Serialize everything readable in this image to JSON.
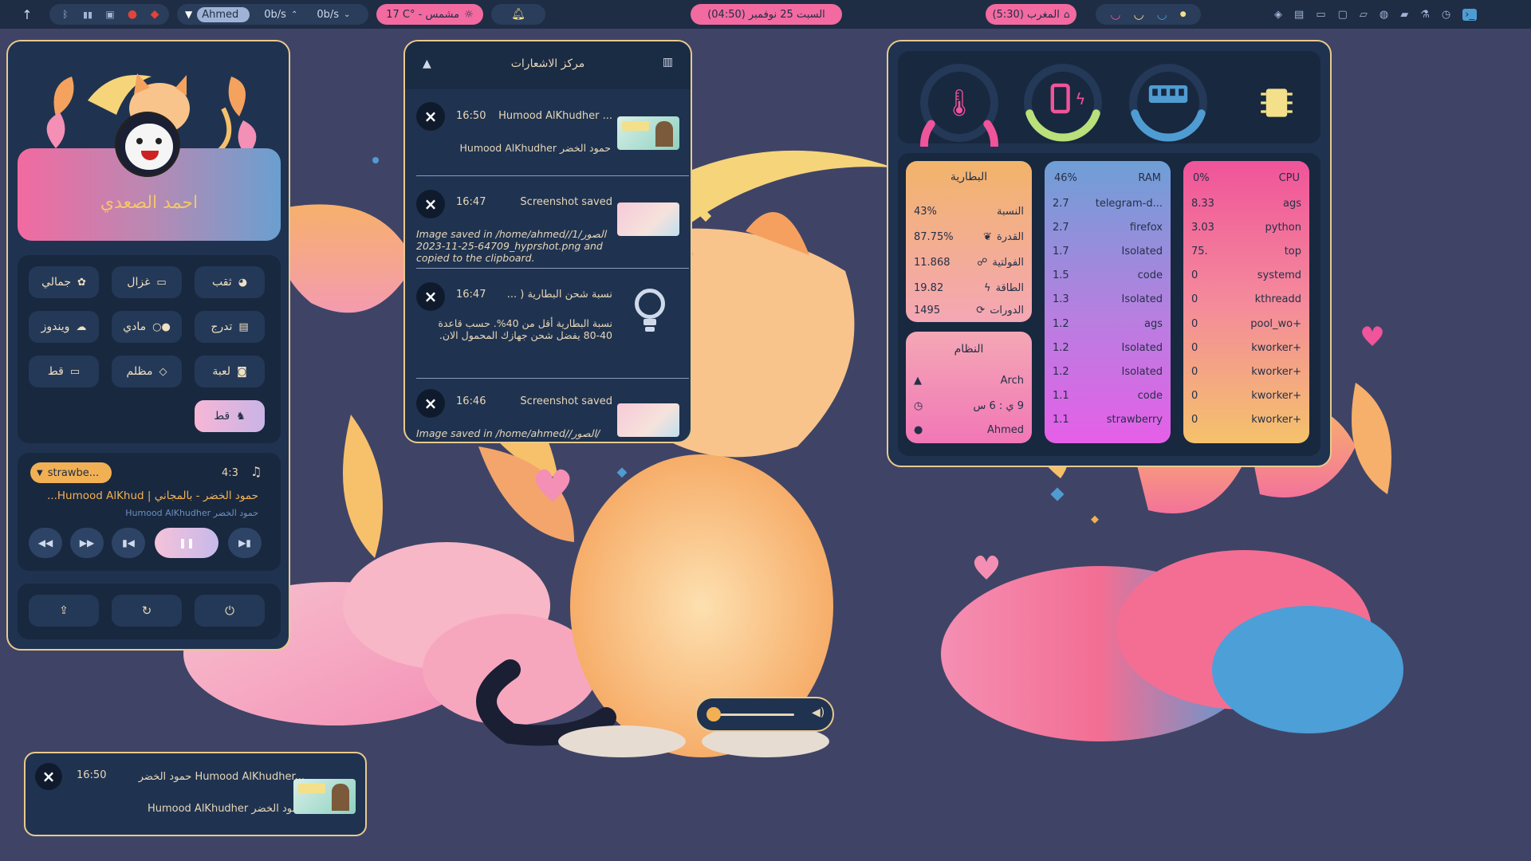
{
  "colors": {
    "bar_bg": "#1e2d44",
    "panel_bg": "#1f3350",
    "panel_border": "#e9c98d",
    "accent_orange": "#f2b054",
    "accent_pink": "#f0549a",
    "accent_green": "#b9e07a",
    "accent_blue": "#4f9cd3",
    "accent_yellow": "#f4e08a"
  },
  "topbar": {
    "up_icon": "arrow-up-icon",
    "tray_icons": [
      "bluetooth-icon",
      "signal-icon",
      "sd-card-icon",
      "red-app-icon",
      "red-app-icon-2"
    ],
    "network_user": "Ahmed",
    "net_down": "0b/s",
    "net_up": "0b/s",
    "weather": "17 C° - مشمس",
    "weather_icon": "sun-icon",
    "notification_icon": "bell-ring-icon",
    "clock": "السبت 25 نوفمبر (04:50)",
    "prayer": "المغرب (5:30)",
    "prayer_icon": "mosque-icon",
    "right_icons": [
      "layers-icon",
      "file-icon",
      "ticket-icon",
      "box-icon",
      "chat-icon",
      "database-icon",
      "folder-icon",
      "flask-icon",
      "history-icon",
      "terminal-icon"
    ]
  },
  "left_panel": {
    "user_name": "احمد الصعدي",
    "quick_buttons": [
      {
        "label": "ثقب",
        "icon": "blackhole-icon"
      },
      {
        "label": "غزال",
        "icon": "monitor-icon"
      },
      {
        "label": "جمالي",
        "icon": "palette-icon"
      },
      {
        "label": "تدرج",
        "icon": "gradient-icon"
      },
      {
        "label": "مادي",
        "icon": "material-icon"
      },
      {
        "label": "ويندوز",
        "icon": "windows-icon"
      },
      {
        "label": "لعبة",
        "icon": "gamepad-icon"
      },
      {
        "label": "مظلم",
        "icon": "dark-icon"
      },
      {
        "label": "قط",
        "icon": "monitor-icon"
      },
      {
        "label": "قط",
        "icon": "cat-icon"
      }
    ],
    "media": {
      "player": "strawbe...",
      "position": "4:3",
      "title": "حمود الخضر - بالمجاني | Humood AlKhud...",
      "artist": "حمود الخضر Humood AlKhudher",
      "controls": [
        "rewind-icon",
        "fast-forward-icon",
        "previous-icon",
        "pause-icon",
        "next-icon"
      ]
    },
    "power_buttons": [
      "logout-icon",
      "restart-icon",
      "power-icon"
    ]
  },
  "notification_center": {
    "title": "مركز الاشعارات",
    "items": [
      {
        "time": "16:50",
        "title": "Humood AlKhudher ...",
        "body": "حمود الخضر Humood AlKhudher",
        "thumb": "album-art"
      },
      {
        "time": "16:47",
        "title": "Screenshot saved",
        "body": "Image saved in /home/ahmed//الصور/164709-25-11-2023_hyprshot.png and copied to the clipboard.",
        "thumb": "screenshot"
      },
      {
        "time": "16:47",
        "title": "نسبة شحن البطارية ( ...",
        "body": "نسبة البطارية أقل من 40%. حسب قاعدة 40-80 يفضل شحن جهازك المحمول الان.",
        "thumb": "lightbulb-icon"
      },
      {
        "time": "16:46",
        "title": "Screenshot saved",
        "body": "Image saved in /home/ahmed//الصور/",
        "thumb": "screenshot"
      }
    ]
  },
  "system_monitor": {
    "gauges": [
      {
        "name": "temperature",
        "icon": "thermometer-icon",
        "color": "#f0549a",
        "value": 0.55
      },
      {
        "name": "battery",
        "icon": "battery-charging-icon",
        "color": "#b9e07a",
        "value": 0.43
      },
      {
        "name": "memory",
        "icon": "ram-icon",
        "color": "#4f9cd3",
        "value": 0.46
      },
      {
        "name": "cpu",
        "icon": "cpu-icon",
        "color": "#f4e08a",
        "value": 0.0
      }
    ],
    "battery": {
      "title": "البطارية",
      "rows": [
        {
          "label": "النسبة",
          "value": "43%"
        },
        {
          "label": "القدرة",
          "value": "87.75%"
        },
        {
          "label": "الفولتية",
          "value": "11.868"
        },
        {
          "label": "الطاقة",
          "value": "19.82"
        },
        {
          "label": "الدورات",
          "value": "1495"
        }
      ]
    },
    "system": {
      "title": "النظام",
      "rows": [
        {
          "icon": "arch-icon",
          "value": "Arch"
        },
        {
          "icon": "clock-icon",
          "value": "9 ي : 6 س"
        },
        {
          "icon": "user-icon",
          "value": "Ahmed"
        }
      ]
    },
    "ram": {
      "title": "RAM",
      "percent": "46%",
      "rows": [
        {
          "value": "2.7",
          "name": "telegram-d..."
        },
        {
          "value": "2.7",
          "name": "firefox"
        },
        {
          "value": "1.7",
          "name": "Isolated"
        },
        {
          "value": "1.5",
          "name": "code"
        },
        {
          "value": "1.3",
          "name": "Isolated"
        },
        {
          "value": "1.2",
          "name": "ags"
        },
        {
          "value": "1.2",
          "name": "Isolated"
        },
        {
          "value": "1.2",
          "name": "Isolated"
        },
        {
          "value": "1.1",
          "name": "code"
        },
        {
          "value": "1.1",
          "name": "strawberry"
        }
      ]
    },
    "cpu": {
      "title": "CPU",
      "percent": "0%",
      "rows": [
        {
          "value": "8.33",
          "name": "ags"
        },
        {
          "value": "3.03",
          "name": "python"
        },
        {
          "value": "75.",
          "name": "top"
        },
        {
          "value": "0",
          "name": "systemd"
        },
        {
          "value": "0",
          "name": "kthreadd"
        },
        {
          "value": "0",
          "name": "pool_wo+"
        },
        {
          "value": "0",
          "name": "kworker+"
        },
        {
          "value": "0",
          "name": "kworker+"
        },
        {
          "value": "0",
          "name": "kworker+"
        },
        {
          "value": "0",
          "name": "kworker+"
        }
      ]
    }
  },
  "volume": {
    "level": 0.0,
    "icon": "speaker-icon"
  },
  "popup_notification": {
    "time": "16:50",
    "title": "حمود الخضر Humood AlKhudher...",
    "body": "حمود الخضر Humood AlKhudher",
    "thumb": "album-art"
  }
}
